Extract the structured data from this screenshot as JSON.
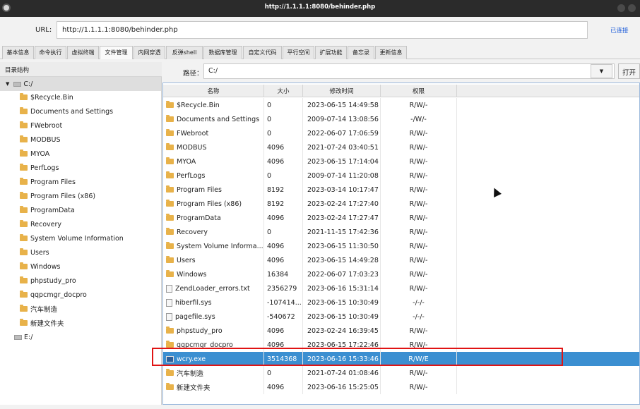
{
  "window": {
    "title": "http://1.1.1.1:8080/behinder.php"
  },
  "urlbar": {
    "label": "URL:",
    "value": "http://1.1.1.1:8080/behinder.php",
    "status": "已连接"
  },
  "tabs": [
    "基本信息",
    "命令执行",
    "虚拟终端",
    "文件管理",
    "内网穿透",
    "反弹shell",
    "数据库管理",
    "自定义代码",
    "平行空间",
    "扩展功能",
    "备忘录",
    "更新信息"
  ],
  "active_tab": "文件管理",
  "tree": {
    "header": "目录结构",
    "root": "C:/",
    "folders": [
      "$Recycle.Bin",
      "Documents and Settings",
      "FWebroot",
      "MODBUS",
      "MYOA",
      "PerfLogs",
      "Program Files",
      "Program Files (x86)",
      "ProgramData",
      "Recovery",
      "System Volume Information",
      "Users",
      "Windows",
      "phpstudy_pro",
      "qqpcmgr_docpro",
      "汽车制造",
      "新建文件夹"
    ],
    "other_drive": "E:/"
  },
  "path": {
    "label": "路径：",
    "value": "C:/",
    "open_label": "打开"
  },
  "table": {
    "columns": [
      "名称",
      "大小",
      "修改时间",
      "权限"
    ],
    "rows": [
      {
        "name": "$Recycle.Bin",
        "size": "0",
        "time": "2023-06-15 14:49:58",
        "perm": "R/W/-",
        "type": "folder"
      },
      {
        "name": "Documents and Settings",
        "size": "0",
        "time": "2009-07-14 13:08:56",
        "perm": "-/W/-",
        "type": "folder"
      },
      {
        "name": "FWebroot",
        "size": "0",
        "time": "2022-06-07 17:06:59",
        "perm": "R/W/-",
        "type": "folder"
      },
      {
        "name": "MODBUS",
        "size": "4096",
        "time": "2021-07-24 03:40:51",
        "perm": "R/W/-",
        "type": "folder"
      },
      {
        "name": "MYOA",
        "size": "4096",
        "time": "2023-06-15 17:14:04",
        "perm": "R/W/-",
        "type": "folder"
      },
      {
        "name": "PerfLogs",
        "size": "0",
        "time": "2009-07-14 11:20:08",
        "perm": "R/W/-",
        "type": "folder"
      },
      {
        "name": "Program Files",
        "size": "8192",
        "time": "2023-03-14 10:17:47",
        "perm": "R/W/-",
        "type": "folder"
      },
      {
        "name": "Program Files (x86)",
        "size": "8192",
        "time": "2023-02-24 17:27:40",
        "perm": "R/W/-",
        "type": "folder"
      },
      {
        "name": "ProgramData",
        "size": "4096",
        "time": "2023-02-24 17:27:47",
        "perm": "R/W/-",
        "type": "folder"
      },
      {
        "name": "Recovery",
        "size": "0",
        "time": "2021-11-15 17:42:36",
        "perm": "R/W/-",
        "type": "folder"
      },
      {
        "name": "System Volume Informa...",
        "size": "4096",
        "time": "2023-06-15 11:30:50",
        "perm": "R/W/-",
        "type": "folder"
      },
      {
        "name": "Users",
        "size": "4096",
        "time": "2023-06-15 14:49:28",
        "perm": "R/W/-",
        "type": "folder"
      },
      {
        "name": "Windows",
        "size": "16384",
        "time": "2022-06-07 17:03:23",
        "perm": "R/W/-",
        "type": "folder"
      },
      {
        "name": "ZendLoader_errors.txt",
        "size": "2356279",
        "time": "2023-06-16 15:31:14",
        "perm": "R/W/-",
        "type": "file"
      },
      {
        "name": "hiberfil.sys",
        "size": "-107414...",
        "time": "2023-06-15 10:30:49",
        "perm": "-/-/-",
        "type": "file"
      },
      {
        "name": "pagefile.sys",
        "size": "-540672",
        "time": "2023-06-15 10:30:49",
        "perm": "-/-/-",
        "type": "file"
      },
      {
        "name": "phpstudy_pro",
        "size": "4096",
        "time": "2023-02-24 16:39:45",
        "perm": "R/W/-",
        "type": "folder"
      },
      {
        "name": "qqpcmgr_docpro",
        "size": "4096",
        "time": "2023-06-15 17:22:46",
        "perm": "R/W/-",
        "type": "folder"
      },
      {
        "name": "wcry.exe",
        "size": "3514368",
        "time": "2023-06-16 15:33:46",
        "perm": "R/W/E",
        "type": "exe",
        "selected": true
      },
      {
        "name": "汽车制造",
        "size": "0",
        "time": "2021-07-24 01:08:46",
        "perm": "R/W/-",
        "type": "folder"
      },
      {
        "name": "新建文件夹",
        "size": "4096",
        "time": "2023-06-16 15:25:05",
        "perm": "R/W/-",
        "type": "folder"
      }
    ]
  },
  "colors": {
    "selection": "#3b8fd1",
    "highlight_box": "#e01414",
    "folder": "#e8b24a",
    "link": "#1a5ad9"
  }
}
